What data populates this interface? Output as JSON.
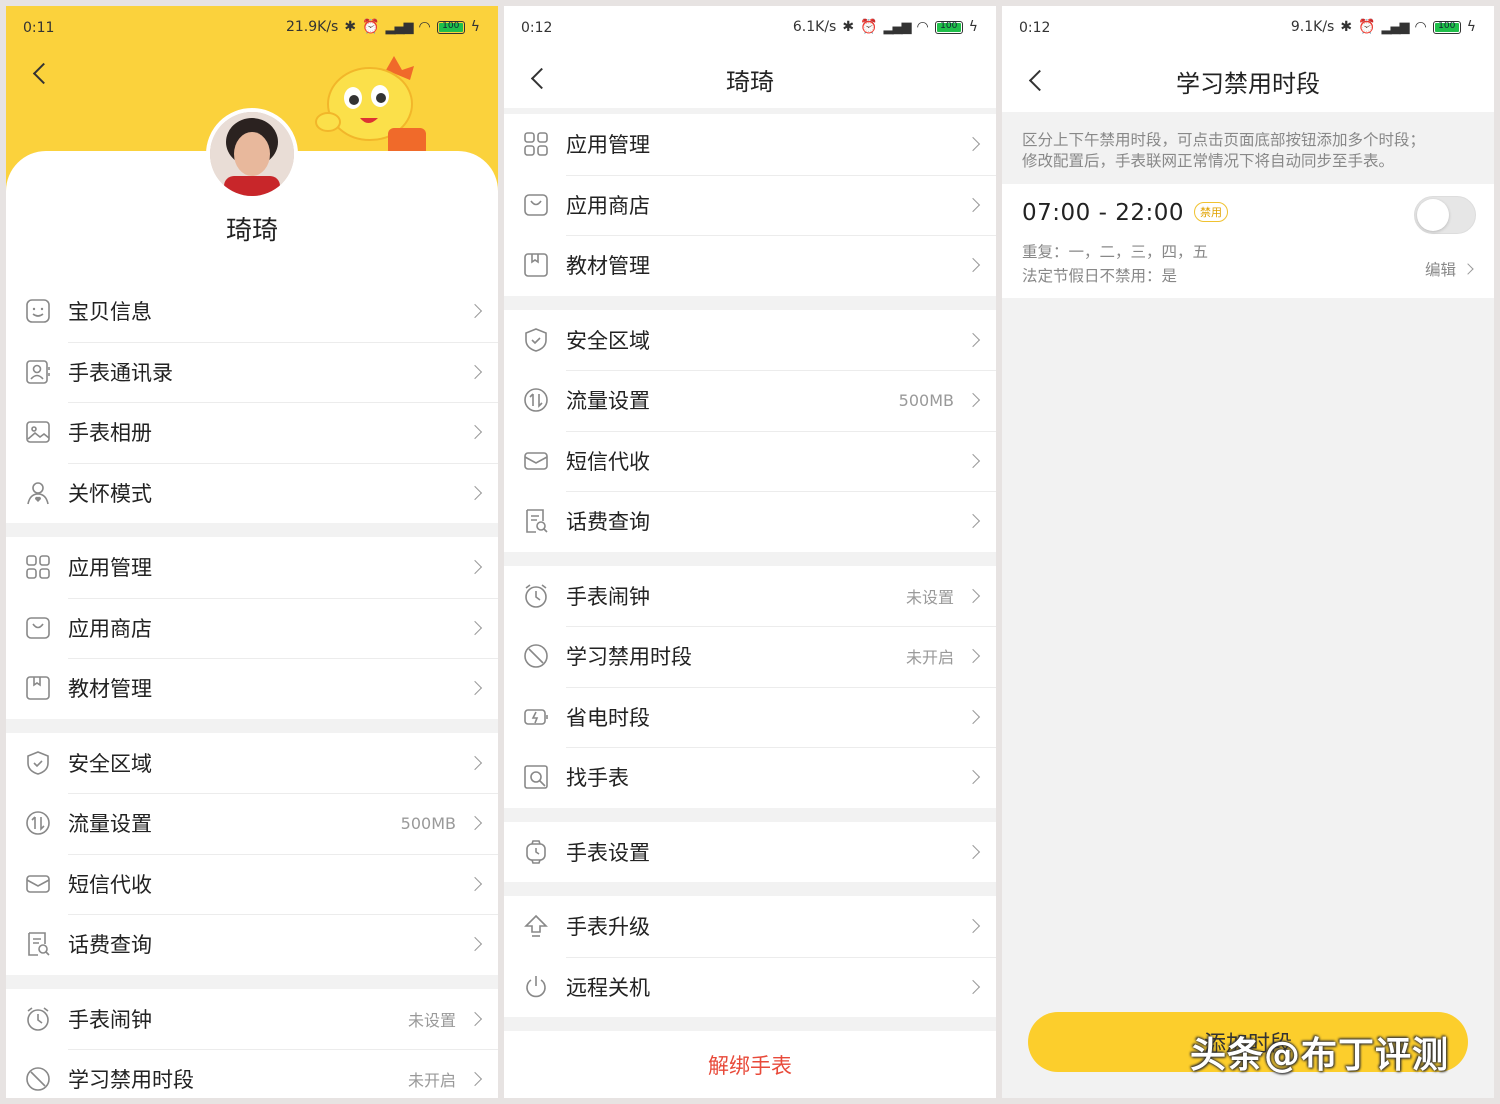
{
  "panel1": {
    "status": {
      "time": "0:11",
      "speed": "21.9K/s",
      "battery": "100"
    },
    "child_name": "琦琦",
    "groups": [
      [
        {
          "icon": "face-icon",
          "label": "宝贝信息",
          "value": ""
        },
        {
          "icon": "contacts-icon",
          "label": "手表通讯录",
          "value": ""
        },
        {
          "icon": "photo-icon",
          "label": "手表相册",
          "value": ""
        },
        {
          "icon": "care-icon",
          "label": "关怀模式",
          "value": ""
        }
      ],
      [
        {
          "icon": "apps-icon",
          "label": "应用管理",
          "value": ""
        },
        {
          "icon": "store-icon",
          "label": "应用商店",
          "value": ""
        },
        {
          "icon": "book-icon",
          "label": "教材管理",
          "value": ""
        }
      ],
      [
        {
          "icon": "shield-icon",
          "label": "安全区域",
          "value": ""
        },
        {
          "icon": "data-icon",
          "label": "流量设置",
          "value": "500MB"
        },
        {
          "icon": "mail-icon",
          "label": "短信代收",
          "value": ""
        },
        {
          "icon": "bill-icon",
          "label": "话费查询",
          "value": ""
        }
      ],
      [
        {
          "icon": "alarm-icon",
          "label": "手表闹钟",
          "value": "未设置"
        },
        {
          "icon": "ban-icon",
          "label": "学习禁用时段",
          "value": "未开启"
        }
      ]
    ]
  },
  "panel2": {
    "status": {
      "time": "0:12",
      "speed": "6.1K/s",
      "battery": "100"
    },
    "title": "琦琦",
    "groups": [
      [
        {
          "icon": "apps-icon",
          "label": "应用管理",
          "value": ""
        },
        {
          "icon": "store-icon",
          "label": "应用商店",
          "value": ""
        },
        {
          "icon": "book-icon",
          "label": "教材管理",
          "value": ""
        }
      ],
      [
        {
          "icon": "shield-icon",
          "label": "安全区域",
          "value": ""
        },
        {
          "icon": "data-icon",
          "label": "流量设置",
          "value": "500MB"
        },
        {
          "icon": "mail-icon",
          "label": "短信代收",
          "value": ""
        },
        {
          "icon": "bill-icon",
          "label": "话费查询",
          "value": ""
        }
      ],
      [
        {
          "icon": "alarm-icon",
          "label": "手表闹钟",
          "value": "未设置"
        },
        {
          "icon": "ban-icon",
          "label": "学习禁用时段",
          "value": "未开启"
        },
        {
          "icon": "battery-saver-icon",
          "label": "省电时段",
          "value": ""
        },
        {
          "icon": "find-watch-icon",
          "label": "找手表",
          "value": ""
        }
      ],
      [
        {
          "icon": "watch-settings-icon",
          "label": "手表设置",
          "value": ""
        }
      ],
      [
        {
          "icon": "upgrade-icon",
          "label": "手表升级",
          "value": ""
        },
        {
          "icon": "power-icon",
          "label": "远程关机",
          "value": ""
        }
      ]
    ],
    "unbind_label": "解绑手表"
  },
  "panel3": {
    "status": {
      "time": "0:12",
      "speed": "9.1K/s",
      "battery": "100"
    },
    "title": "学习禁用时段",
    "note_line1": "区分上下午禁用时段，可点击页面底部按钮添加多个时段；",
    "note_line2": "修改配置后，手表联网正常情况下将自动同步至手表。",
    "slot": {
      "time": "07:00 - 22:00",
      "badge": "禁用",
      "enabled": false,
      "repeat": "重复：一，二，三，四，五",
      "holiday": "法定节假日不禁用：是",
      "edit_label": "编辑"
    },
    "add_button_label": "添加时段"
  },
  "watermark": "头条@布丁评测",
  "colors": {
    "accent_yellow": "#fcce2c",
    "danger_red": "#e84a3a"
  }
}
